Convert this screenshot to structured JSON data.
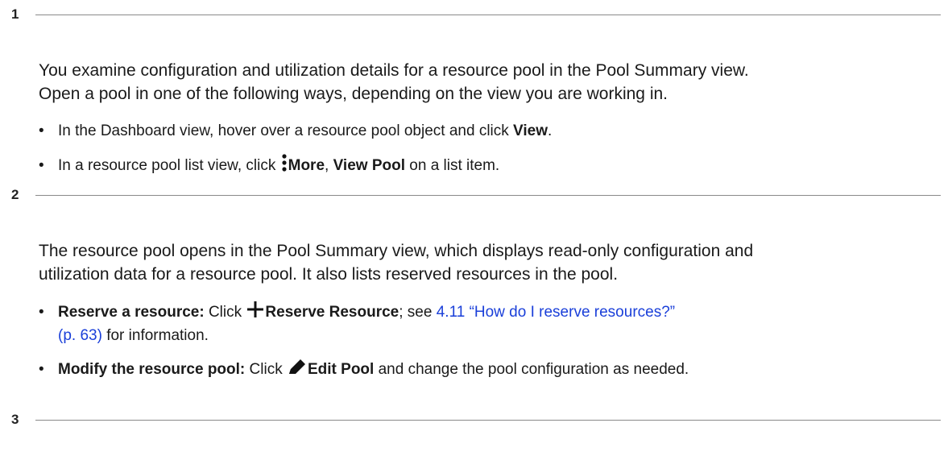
{
  "steps": [
    {
      "number": "1"
    },
    {
      "number": "2"
    },
    {
      "number": "3"
    }
  ],
  "step1": {
    "para_line1": "You examine configuration and utilization details for a resource pool in the Pool Summary view.",
    "para_line2": "Open a pool in one of the following ways, depending on the view you are working in.",
    "bullet1": {
      "text_before": "In the Dashboard view, hover over a resource pool object and click ",
      "bold": "View",
      "text_after": "."
    },
    "bullet2": {
      "text_before": "In a resource pool list view, click ",
      "icon": "more-vertical-icon",
      "bold1": "More",
      "sep": ", ",
      "bold2": "View Pool",
      "text_after": " on a list item."
    }
  },
  "step2": {
    "para_line1": "The resource pool opens in the Pool Summary view, which displays read-only configuration and",
    "para_line2": "utilization data for a resource pool. It also lists reserved resources in the pool.",
    "bullet1": {
      "bold_label": "Reserve a resource:",
      "text_click": " Click ",
      "icon": "plus-icon",
      "bold_action": "Reserve Resource",
      "text_mid": "; see ",
      "link_line1": "4.11 “How do I reserve resources?”",
      "link_line2": "(p. 63)",
      "text_after": " for information."
    },
    "bullet2": {
      "bold_label": "Modify the resource pool:",
      "text_click": " Click ",
      "icon": "pencil-icon",
      "bold_action": "Edit Pool",
      "text_after": " and change the pool configuration as needed."
    }
  },
  "colors": {
    "text": "#1a1a1a",
    "link": "#1a3fd9",
    "rule": "#8a8a8a"
  }
}
